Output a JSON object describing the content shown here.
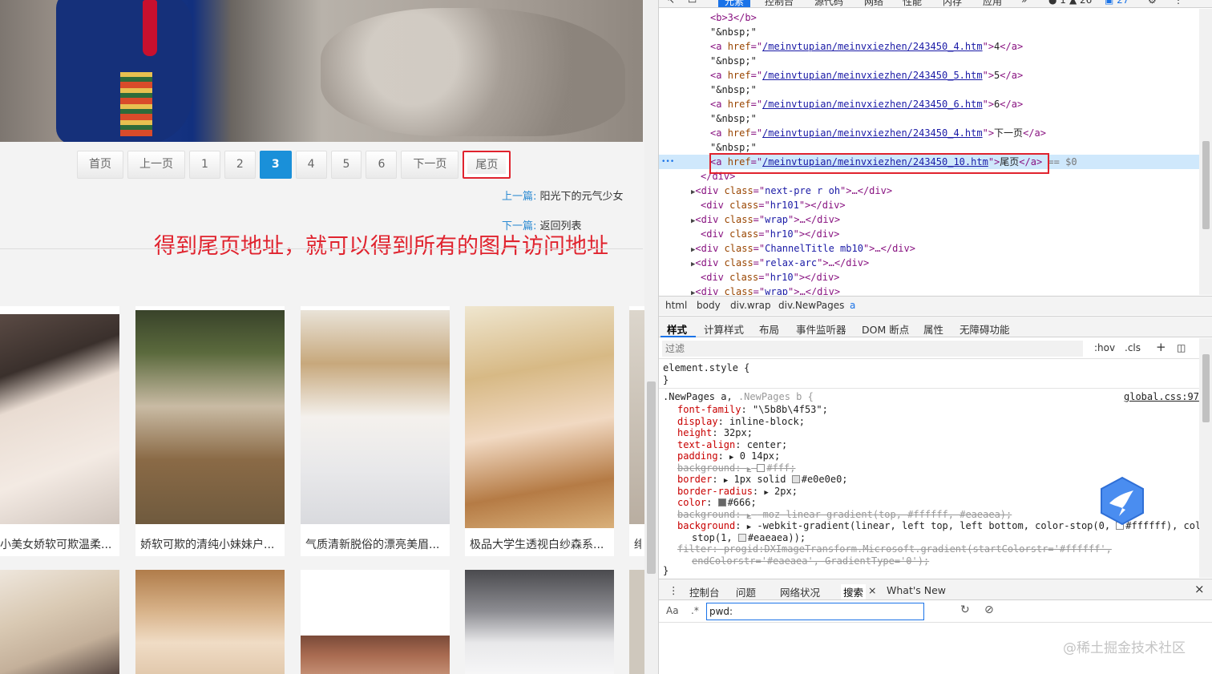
{
  "page": {
    "pagination": [
      "首页",
      "上一页",
      "1",
      "2",
      "3",
      "4",
      "5",
      "6",
      "下一页",
      "尾页"
    ],
    "current_page": "3",
    "prev_post_label": "上一篇:",
    "prev_post_title": "阳光下的元气少女",
    "next_post_label": "下一篇:",
    "back_to_list": "返回列表",
    "annotation": "得到尾页地址，就可以得到所有的图片访问地址",
    "cards": [
      {
        "caption": "小美女娇软可欺温柔..."
      },
      {
        "caption": "娇软可欺的清纯小妹妹户..."
      },
      {
        "caption": "气质清新脱俗的漂亮美眉..."
      },
      {
        "caption": "极品大学生透视白纱森系..."
      },
      {
        "caption": "绯"
      }
    ]
  },
  "devtools": {
    "tabs": [
      "元素",
      "控制台",
      "源代码",
      "网络",
      "性能",
      "内存",
      "应用",
      "»"
    ],
    "badges": {
      "errors": "1",
      "warnings": "26",
      "messages": "27"
    },
    "dom": {
      "b_line": "<b>3</b>",
      "nbsp": "\"&nbsp;\"",
      "links": [
        {
          "href": "/meinvtupian/meinvxiezhen/243450_4.htm",
          "text": "4"
        },
        {
          "href": "/meinvtupian/meinvxiezhen/243450_5.htm",
          "text": "5"
        },
        {
          "href": "/meinvtupian/meinvxiezhen/243450_6.htm",
          "text": "6"
        },
        {
          "href": "/meinvtupian/meinvxiezhen/243450_4.htm",
          "text": "下一页"
        },
        {
          "href": "/meinvtupian/meinvxiezhen/243450_10.htm",
          "text": "尾页"
        }
      ],
      "selected_suffix": "== $0",
      "close_div": "</div>",
      "after": [
        {
          "cls": "next-pre r oh",
          "collapsed": true
        },
        {
          "cls": "hr101",
          "collapsed": false
        },
        {
          "cls": "wrap",
          "collapsed": true
        },
        {
          "cls": "hr10",
          "collapsed": false
        },
        {
          "cls": "ChannelTitle mb10",
          "collapsed": true
        },
        {
          "cls": "relax-arc",
          "collapsed": true
        },
        {
          "cls": "hr10",
          "collapsed": false
        },
        {
          "cls": "wrap",
          "collapsed": true
        }
      ]
    },
    "breadcrumbs": [
      "html",
      "body",
      "div.wrap",
      "div.NewPages",
      "a"
    ],
    "panel_tabs": [
      "样式",
      "计算样式",
      "布局",
      "事件监听器",
      "DOM 断点",
      "属性",
      "无障碍功能"
    ],
    "filter_placeholder": "过滤",
    "filter_tools": [
      ":hov",
      ".cls",
      "+"
    ],
    "styles": {
      "element_style": "element.style {",
      "close": "}",
      "rule_selector": ".NewPages a,",
      "rule_selector_dim": ".NewPages b {",
      "source": "global.css:97",
      "font_family": "\"\\5b8b\\4f53\";",
      "display": "inline-block;",
      "height": "32px;",
      "text_align": "center;",
      "padding": "0 14px;",
      "background_struck": "#fff;",
      "border": "1px solid",
      "border_color": "#e0e0e0;",
      "border_radius": "2px;",
      "color": "#666;",
      "moz_bg": "-moz-linear-gradient(top, #ffffff, #eaeaea);",
      "webkit_bg_1": "-webkit-gradient(linear, left top, left bottom, color-stop(0,",
      "webkit_bg_stop_color": "#ffffff",
      "webkit_bg_1_end": "), color-",
      "webkit_bg_2": "stop(1,",
      "webkit_bg_2_color": "#eaeaea",
      "webkit_bg_2_end": "));",
      "filter_1": "progid:DXImageTransform.Microsoft.gradient(startColorstr='#ffffff',",
      "filter_2": "endColorstr='#eaeaea', GradientType='0');"
    },
    "drawer_tabs": [
      "控制台",
      "问题",
      "网络状况",
      "搜索",
      "What's New"
    ],
    "search": {
      "case_label": "Aa",
      "regex_label": ".*",
      "value": "pwd:"
    },
    "watermark": "@稀土掘金技术社区"
  }
}
